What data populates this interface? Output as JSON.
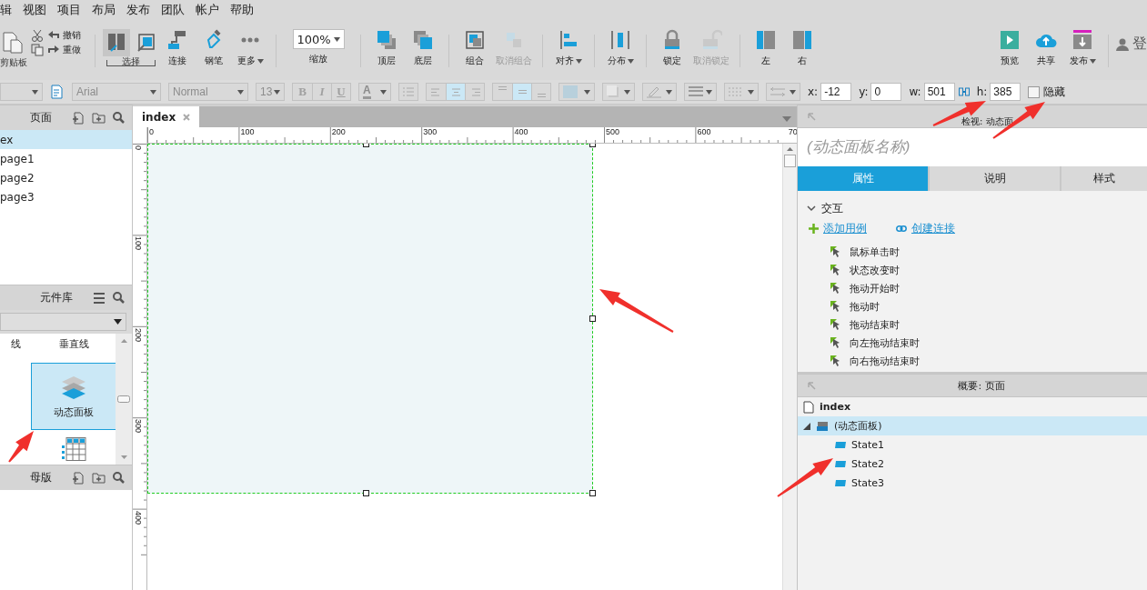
{
  "menu": [
    "辑",
    "视图",
    "项目",
    "布局",
    "发布",
    "团队",
    "帐户",
    "帮助"
  ],
  "toolbar": {
    "clipboard": {
      "label": "剪贴板",
      "undo": "撤销",
      "redo": "重做"
    },
    "select": {
      "label": "选择",
      "modes": [
        {
          "selected": true
        },
        {
          "selected": false
        }
      ]
    },
    "groups": [
      {
        "items": [
          {
            "kind": "connect",
            "label": "连接",
            "dropdown": false,
            "disabled": false
          },
          {
            "kind": "pen",
            "label": "钢笔",
            "dropdown": false,
            "disabled": false
          },
          {
            "kind": "more",
            "label": "更多",
            "dropdown": true,
            "disabled": false
          }
        ]
      },
      {
        "items": [
          {
            "kind": "zoom",
            "label": "缩放",
            "value": "100%",
            "dropdown": true,
            "disabled": false
          }
        ]
      },
      {
        "items": [
          {
            "kind": "front",
            "label": "顶层",
            "dropdown": false,
            "disabled": false
          },
          {
            "kind": "back",
            "label": "底层",
            "dropdown": false,
            "disabled": false
          }
        ]
      },
      {
        "items": [
          {
            "kind": "group",
            "label": "组合",
            "dropdown": false,
            "disabled": false
          },
          {
            "kind": "ungroup",
            "label": "取消组合",
            "dropdown": false,
            "disabled": true
          }
        ]
      },
      {
        "items": [
          {
            "kind": "align",
            "label": "对齐",
            "dropdown": true,
            "disabled": false
          }
        ]
      },
      {
        "items": [
          {
            "kind": "distribute",
            "label": "分布",
            "dropdown": true,
            "disabled": false
          }
        ]
      },
      {
        "items": [
          {
            "kind": "lock",
            "label": "锁定",
            "dropdown": false,
            "disabled": false
          },
          {
            "kind": "unlock",
            "label": "取消锁定",
            "dropdown": false,
            "disabled": true
          }
        ]
      },
      {
        "items": [
          {
            "kind": "left",
            "label": "左",
            "dropdown": false,
            "disabled": false
          },
          {
            "kind": "right",
            "label": "右",
            "dropdown": false,
            "disabled": false
          }
        ]
      }
    ],
    "right_items": [
      {
        "kind": "preview",
        "label": "预览",
        "dropdown": false,
        "disabled": false
      },
      {
        "kind": "share",
        "label": "共享",
        "dropdown": false,
        "disabled": false
      },
      {
        "kind": "publish",
        "label": "发布",
        "dropdown": true,
        "disabled": false
      }
    ],
    "account": "登"
  },
  "format": {
    "font_family": "Arial",
    "font_style": "Normal",
    "font_size": "13",
    "text_styles": [
      "B",
      "I",
      "U"
    ],
    "font_color": "A",
    "align": [
      {
        "selected": false
      },
      {
        "selected": true
      },
      {
        "selected": false
      }
    ],
    "valign": [
      {
        "selected": false
      },
      {
        "selected": true
      },
      {
        "selected": false
      }
    ],
    "geometry": [
      {
        "label": "x:",
        "value": "-12"
      },
      {
        "label": "y:",
        "value": "0"
      },
      {
        "label": "w:",
        "value": "501"
      },
      {
        "label": "h:",
        "value": "385"
      }
    ],
    "hidden": {
      "label": "隐藏",
      "checked": false
    }
  },
  "pages": {
    "title": "页面",
    "items": [
      {
        "label": "ex",
        "selected": true,
        "children": [
          {
            "label": "page1",
            "selected": false
          },
          {
            "label": "page2",
            "selected": false
          },
          {
            "label": "page3",
            "selected": false
          }
        ]
      }
    ]
  },
  "library": {
    "title": "元件库",
    "widgets": [
      {
        "kind": "text",
        "label": "线",
        "selected": false
      },
      {
        "kind": "text",
        "label": "垂直线",
        "selected": false
      },
      {
        "kind": "panel",
        "label": "动态面板",
        "selected": true
      },
      {
        "kind": "table",
        "selected": false
      }
    ]
  },
  "masters": {
    "title": "母版"
  },
  "canvas": {
    "tab": "index",
    "x_labels": [
      "0",
      "100",
      "200",
      "300",
      "400",
      "500",
      "600",
      "70"
    ],
    "y_labels": [
      "0",
      "100",
      "200",
      "300",
      "400"
    ]
  },
  "inspector": {
    "title": "检视: 动态面",
    "name_placeholder": "(动态面板名称)",
    "tabs": [
      {
        "label": "属性",
        "selected": true
      },
      {
        "label": "说明",
        "selected": false
      },
      {
        "label": "样式",
        "selected": false
      }
    ],
    "section": {
      "label": "交互",
      "expanded": true
    },
    "add_case": "添加用例",
    "create_link": "创建连接",
    "events": [
      "鼠标单击时",
      "状态改变时",
      "拖动开始时",
      "拖动时",
      "拖动结束时",
      "向左拖动结束时",
      "向右拖动结束时"
    ]
  },
  "outline": {
    "title": "概要: 页面",
    "page": "index",
    "tree": [
      {
        "label": "(动态面板)",
        "selected": true,
        "expanded": true,
        "children": [
          {
            "label": "State1",
            "selected": false
          },
          {
            "label": "State2",
            "selected": false
          },
          {
            "label": "State3",
            "selected": false
          }
        ]
      }
    ]
  }
}
